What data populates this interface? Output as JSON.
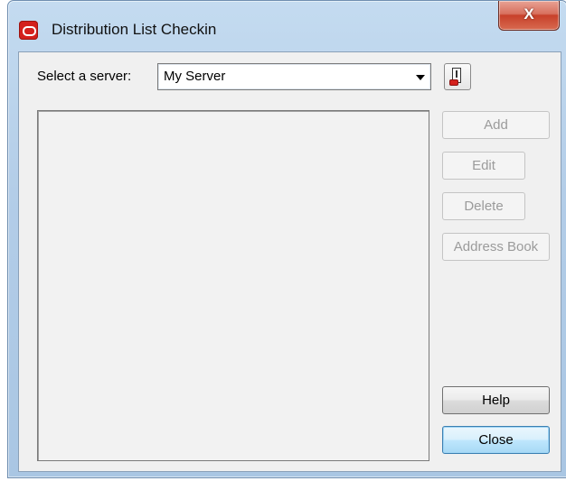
{
  "window": {
    "title": "Distribution List Checkin",
    "close_glyph": "X"
  },
  "server": {
    "label": "Select a server:",
    "value": "My Server"
  },
  "buttons": {
    "add": "Add",
    "edit": "Edit",
    "delete": "Delete",
    "address_book": "Address Book",
    "help": "Help",
    "close": "Close"
  },
  "icons": {
    "app": "oracle-logo-icon",
    "server_lookup": "server-lookup-icon",
    "dropdown": "chevron-down-icon"
  },
  "colors": {
    "accent_red": "#d4201c",
    "frame_blue": "#b3cde8",
    "focus_blue": "#3c7fb1"
  }
}
